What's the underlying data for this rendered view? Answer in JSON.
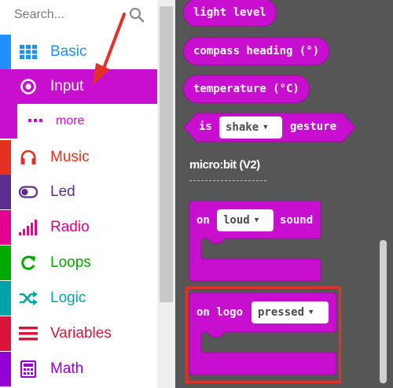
{
  "search": {
    "placeholder": "Search..."
  },
  "categories": [
    {
      "label": "Basic",
      "color": "#1e90ff",
      "icon": "grid-icon"
    },
    {
      "label": "Input",
      "color": "#c80fd0",
      "icon": "target-icon",
      "selected": true
    },
    {
      "label": "more",
      "color": "#c80fd0",
      "icon": "more-dots-icon"
    },
    {
      "label": "Music",
      "color": "#e63022",
      "icon": "headphones-icon"
    },
    {
      "label": "Led",
      "color": "#5c2d91",
      "icon": "toggle-icon"
    },
    {
      "label": "Radio",
      "color": "#e3008c",
      "icon": "signal-bars-icon"
    },
    {
      "label": "Loops",
      "color": "#00aa00",
      "icon": "refresh-icon"
    },
    {
      "label": "Logic",
      "color": "#00a4a6",
      "icon": "shuffle-icon"
    },
    {
      "label": "Variables",
      "color": "#dc143c",
      "icon": "lines-icon"
    },
    {
      "label": "Math",
      "color": "#9400d3",
      "icon": "calculator-icon"
    }
  ],
  "flyout": {
    "light_level": "light level",
    "compass_heading": "compass heading (°)",
    "temperature": "temperature (°C)",
    "is_shake": {
      "prefix": "is",
      "dropdown": "shake",
      "suffix": "gesture"
    },
    "section_title": "micro:bit (V2)",
    "on_loud": {
      "prefix": "on",
      "dropdown": "loud",
      "suffix": "sound"
    },
    "on_logo": {
      "prefix": "on logo",
      "dropdown": "pressed"
    }
  },
  "colors": {
    "input_block": "#c80fd0",
    "flyout_bg": "#565656",
    "annotation": "#e0322a"
  }
}
